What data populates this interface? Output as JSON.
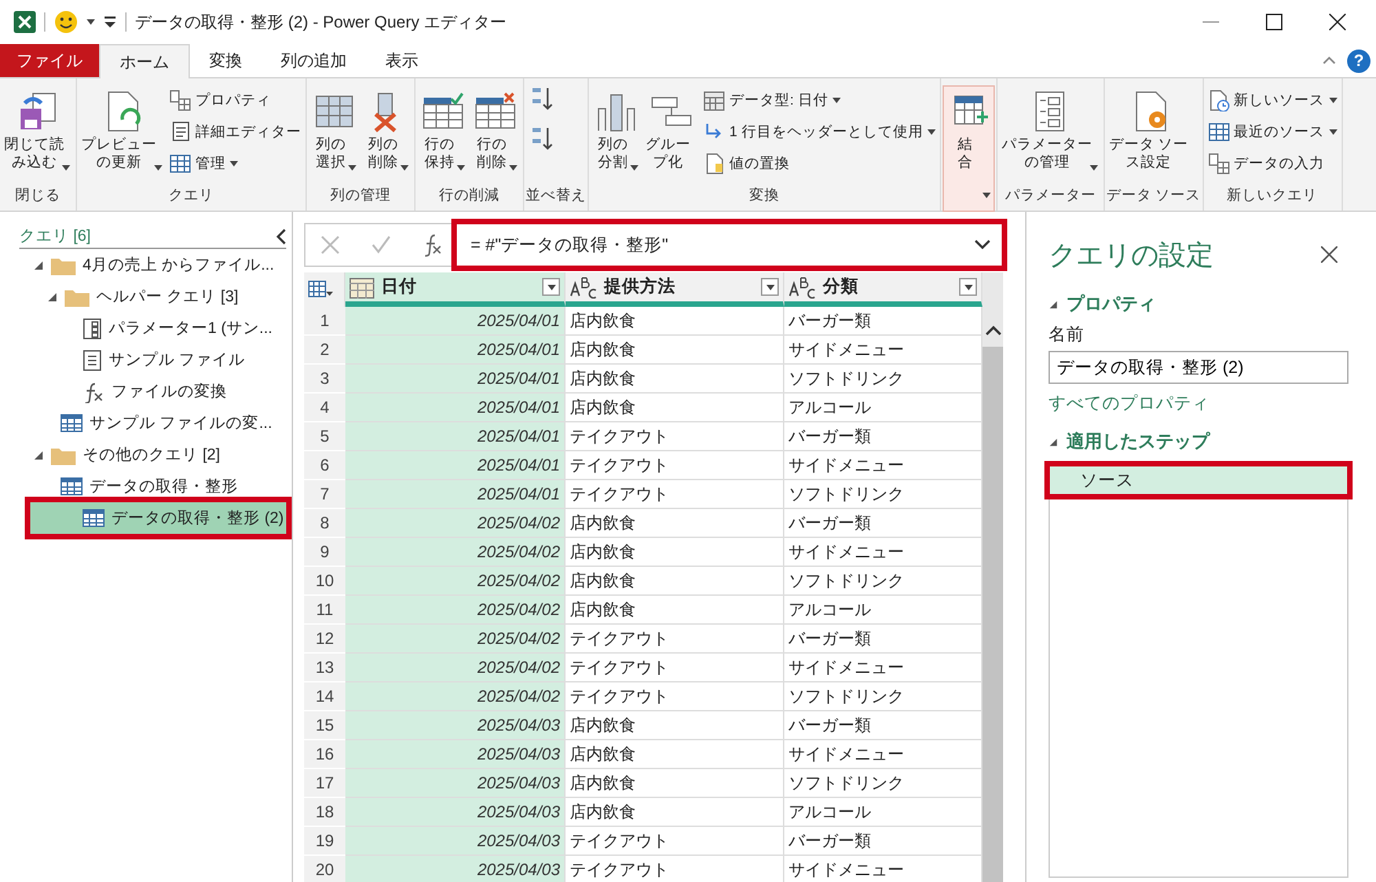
{
  "window": {
    "title": "データの取得・整形 (2) - Power Query エディター",
    "help": "?"
  },
  "ribbon": {
    "tabs": [
      {
        "label": "ファイル",
        "kind": "file",
        "selected": false
      },
      {
        "label": "ホーム",
        "kind": "tab",
        "selected": true
      },
      {
        "label": "変換",
        "kind": "tab",
        "selected": false
      },
      {
        "label": "列の追加",
        "kind": "tab",
        "selected": false
      },
      {
        "label": "表示",
        "kind": "tab",
        "selected": false
      }
    ],
    "groups": [
      {
        "label": "閉じる",
        "buttons": [
          {
            "kind": "large",
            "lines": [
              "閉じて読",
              "み込む"
            ],
            "dropdown": true,
            "highlighted": false
          }
        ]
      },
      {
        "label": "クエリ",
        "buttons": [
          {
            "kind": "large",
            "lines": [
              "プレビュー",
              "の更新"
            ],
            "dropdown": true,
            "highlighted": false
          },
          {
            "kind": "small",
            "label": "プロパティ",
            "dropdown": false
          },
          {
            "kind": "small",
            "label": "詳細エディター",
            "dropdown": false
          },
          {
            "kind": "small",
            "label": "管理",
            "dropdown": true
          }
        ]
      },
      {
        "label": "列の管理",
        "buttons": [
          {
            "kind": "large",
            "lines": [
              "列の",
              "選択"
            ],
            "dropdown": true,
            "highlighted": false
          },
          {
            "kind": "large",
            "lines": [
              "列の",
              "削除"
            ],
            "dropdown": true,
            "highlighted": false
          }
        ]
      },
      {
        "label": "行の削減",
        "buttons": [
          {
            "kind": "large",
            "lines": [
              "行の",
              "保持"
            ],
            "dropdown": true,
            "highlighted": false
          },
          {
            "kind": "large",
            "lines": [
              "行の",
              "削除"
            ],
            "dropdown": true,
            "highlighted": false
          }
        ]
      },
      {
        "label": "並べ替え",
        "buttons": [
          {
            "kind": "icon"
          },
          {
            "kind": "icon"
          }
        ]
      },
      {
        "label": "変換",
        "buttons": [
          {
            "kind": "large",
            "lines": [
              "列の",
              "分割"
            ],
            "dropdown": true,
            "highlighted": false
          },
          {
            "kind": "large",
            "lines": [
              "グルー",
              "プ化"
            ],
            "dropdown": false,
            "highlighted": false
          },
          {
            "kind": "small",
            "label": "データ型: 日付",
            "dropdown": true
          },
          {
            "kind": "small",
            "label": "1 行目をヘッダーとして使用",
            "dropdown": true
          },
          {
            "kind": "small",
            "label": "値の置換",
            "dropdown": false
          }
        ]
      },
      {
        "buttons": [
          {
            "kind": "large",
            "lines": [
              "結",
              "合"
            ],
            "dropdown": true,
            "highlighted": true
          }
        ]
      },
      {
        "label": "パラメーター",
        "buttons": [
          {
            "kind": "large",
            "lines": [
              "パラメーター",
              "の管理"
            ],
            "dropdown": true,
            "highlighted": false
          }
        ]
      },
      {
        "label": "データ ソース",
        "buttons": [
          {
            "kind": "large",
            "lines": [
              "データ ソー",
              "ス設定"
            ],
            "dropdown": false,
            "highlighted": false
          }
        ]
      },
      {
        "label": "新しいクエリ",
        "buttons": [
          {
            "kind": "small",
            "label": "新しいソース",
            "dropdown": true
          },
          {
            "kind": "small",
            "label": "最近のソース",
            "dropdown": true
          },
          {
            "kind": "small",
            "label": "データの入力",
            "dropdown": false
          }
        ]
      }
    ]
  },
  "queries": {
    "title": "クエリ [6]",
    "items": [
      {
        "kind": "folder",
        "label": "4月の売上 からファイル...",
        "expanded": true,
        "children": [
          {
            "kind": "folder",
            "label": "ヘルパー クエリ [3]",
            "expanded": true,
            "children": [
              {
                "kind": "parameter",
                "label": "パラメーター1 (サン...",
                "selected": false,
                "highlighted": false
              },
              {
                "kind": "file",
                "label": "サンプル ファイル",
                "selected": false,
                "highlighted": false
              },
              {
                "kind": "function",
                "label": "ファイルの変換",
                "selected": false,
                "highlighted": false
              }
            ]
          },
          {
            "kind": "table",
            "label": "サンプル ファイルの変...",
            "selected": false,
            "highlighted": false
          }
        ]
      },
      {
        "kind": "folder",
        "label": "その他のクエリ [2]",
        "expanded": true,
        "children": [
          {
            "kind": "table",
            "label": "データの取得・整形",
            "selected": false,
            "highlighted": false
          },
          {
            "kind": "table",
            "label": "データの取得・整形 (2)",
            "selected": true,
            "highlighted": true
          }
        ]
      }
    ]
  },
  "formula": {
    "text": "= #\"データの取得・整形\"",
    "highlighted": true
  },
  "table": {
    "columns": [
      {
        "name": "日付",
        "kind": "date",
        "selected": true
      },
      {
        "name": "提供方法",
        "kind": "text",
        "selected": false
      },
      {
        "name": "分類",
        "kind": "text",
        "selected": false
      }
    ],
    "rows": [
      {
        "number": "1",
        "cells": [
          "2025/04/01",
          "店内飲食",
          "バーガー類"
        ]
      },
      {
        "number": "2",
        "cells": [
          "2025/04/01",
          "店内飲食",
          "サイドメニュー"
        ]
      },
      {
        "number": "3",
        "cells": [
          "2025/04/01",
          "店内飲食",
          "ソフトドリンク"
        ]
      },
      {
        "number": "4",
        "cells": [
          "2025/04/01",
          "店内飲食",
          "アルコール"
        ]
      },
      {
        "number": "5",
        "cells": [
          "2025/04/01",
          "テイクアウト",
          "バーガー類"
        ]
      },
      {
        "number": "6",
        "cells": [
          "2025/04/01",
          "テイクアウト",
          "サイドメニュー"
        ]
      },
      {
        "number": "7",
        "cells": [
          "2025/04/01",
          "テイクアウト",
          "ソフトドリンク"
        ]
      },
      {
        "number": "8",
        "cells": [
          "2025/04/02",
          "店内飲食",
          "バーガー類"
        ]
      },
      {
        "number": "9",
        "cells": [
          "2025/04/02",
          "店内飲食",
          "サイドメニュー"
        ]
      },
      {
        "number": "10",
        "cells": [
          "2025/04/02",
          "店内飲食",
          "ソフトドリンク"
        ]
      },
      {
        "number": "11",
        "cells": [
          "2025/04/02",
          "店内飲食",
          "アルコール"
        ]
      },
      {
        "number": "12",
        "cells": [
          "2025/04/02",
          "テイクアウト",
          "バーガー類"
        ]
      },
      {
        "number": "13",
        "cells": [
          "2025/04/02",
          "テイクアウト",
          "サイドメニュー"
        ]
      },
      {
        "number": "14",
        "cells": [
          "2025/04/02",
          "テイクアウト",
          "ソフトドリンク"
        ]
      },
      {
        "number": "15",
        "cells": [
          "2025/04/03",
          "店内飲食",
          "バーガー類"
        ]
      },
      {
        "number": "16",
        "cells": [
          "2025/04/03",
          "店内飲食",
          "サイドメニュー"
        ]
      },
      {
        "number": "17",
        "cells": [
          "2025/04/03",
          "店内飲食",
          "ソフトドリンク"
        ]
      },
      {
        "number": "18",
        "cells": [
          "2025/04/03",
          "店内飲食",
          "アルコール"
        ]
      },
      {
        "number": "19",
        "cells": [
          "2025/04/03",
          "テイクアウト",
          "バーガー類"
        ]
      },
      {
        "number": "20",
        "cells": [
          "2025/04/03",
          "テイクアウト",
          "サイドメニュー"
        ]
      }
    ]
  },
  "settings": {
    "title": "クエリの設定",
    "properties_heading": "プロパティ",
    "name_label": "名前",
    "name_value": "データの取得・整形 (2)",
    "all_properties": "すべてのプロパティ",
    "steps_heading": "適用したステップ",
    "steps": [
      {
        "label": "ソース",
        "selected": true,
        "highlighted": true
      }
    ]
  }
}
